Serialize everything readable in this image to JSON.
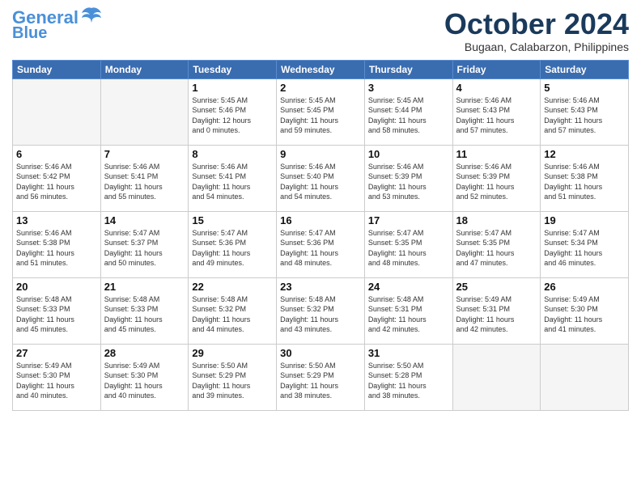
{
  "header": {
    "logo_line1": "General",
    "logo_line2": "Blue",
    "month": "October 2024",
    "location": "Bugaan, Calabarzon, Philippines"
  },
  "days_of_week": [
    "Sunday",
    "Monday",
    "Tuesday",
    "Wednesday",
    "Thursday",
    "Friday",
    "Saturday"
  ],
  "weeks": [
    [
      {
        "day": "",
        "info": ""
      },
      {
        "day": "",
        "info": ""
      },
      {
        "day": "1",
        "info": "Sunrise: 5:45 AM\nSunset: 5:46 PM\nDaylight: 12 hours\nand 0 minutes."
      },
      {
        "day": "2",
        "info": "Sunrise: 5:45 AM\nSunset: 5:45 PM\nDaylight: 11 hours\nand 59 minutes."
      },
      {
        "day": "3",
        "info": "Sunrise: 5:45 AM\nSunset: 5:44 PM\nDaylight: 11 hours\nand 58 minutes."
      },
      {
        "day": "4",
        "info": "Sunrise: 5:46 AM\nSunset: 5:43 PM\nDaylight: 11 hours\nand 57 minutes."
      },
      {
        "day": "5",
        "info": "Sunrise: 5:46 AM\nSunset: 5:43 PM\nDaylight: 11 hours\nand 57 minutes."
      }
    ],
    [
      {
        "day": "6",
        "info": "Sunrise: 5:46 AM\nSunset: 5:42 PM\nDaylight: 11 hours\nand 56 minutes."
      },
      {
        "day": "7",
        "info": "Sunrise: 5:46 AM\nSunset: 5:41 PM\nDaylight: 11 hours\nand 55 minutes."
      },
      {
        "day": "8",
        "info": "Sunrise: 5:46 AM\nSunset: 5:41 PM\nDaylight: 11 hours\nand 54 minutes."
      },
      {
        "day": "9",
        "info": "Sunrise: 5:46 AM\nSunset: 5:40 PM\nDaylight: 11 hours\nand 54 minutes."
      },
      {
        "day": "10",
        "info": "Sunrise: 5:46 AM\nSunset: 5:39 PM\nDaylight: 11 hours\nand 53 minutes."
      },
      {
        "day": "11",
        "info": "Sunrise: 5:46 AM\nSunset: 5:39 PM\nDaylight: 11 hours\nand 52 minutes."
      },
      {
        "day": "12",
        "info": "Sunrise: 5:46 AM\nSunset: 5:38 PM\nDaylight: 11 hours\nand 51 minutes."
      }
    ],
    [
      {
        "day": "13",
        "info": "Sunrise: 5:46 AM\nSunset: 5:38 PM\nDaylight: 11 hours\nand 51 minutes."
      },
      {
        "day": "14",
        "info": "Sunrise: 5:47 AM\nSunset: 5:37 PM\nDaylight: 11 hours\nand 50 minutes."
      },
      {
        "day": "15",
        "info": "Sunrise: 5:47 AM\nSunset: 5:36 PM\nDaylight: 11 hours\nand 49 minutes."
      },
      {
        "day": "16",
        "info": "Sunrise: 5:47 AM\nSunset: 5:36 PM\nDaylight: 11 hours\nand 48 minutes."
      },
      {
        "day": "17",
        "info": "Sunrise: 5:47 AM\nSunset: 5:35 PM\nDaylight: 11 hours\nand 48 minutes."
      },
      {
        "day": "18",
        "info": "Sunrise: 5:47 AM\nSunset: 5:35 PM\nDaylight: 11 hours\nand 47 minutes."
      },
      {
        "day": "19",
        "info": "Sunrise: 5:47 AM\nSunset: 5:34 PM\nDaylight: 11 hours\nand 46 minutes."
      }
    ],
    [
      {
        "day": "20",
        "info": "Sunrise: 5:48 AM\nSunset: 5:33 PM\nDaylight: 11 hours\nand 45 minutes."
      },
      {
        "day": "21",
        "info": "Sunrise: 5:48 AM\nSunset: 5:33 PM\nDaylight: 11 hours\nand 45 minutes."
      },
      {
        "day": "22",
        "info": "Sunrise: 5:48 AM\nSunset: 5:32 PM\nDaylight: 11 hours\nand 44 minutes."
      },
      {
        "day": "23",
        "info": "Sunrise: 5:48 AM\nSunset: 5:32 PM\nDaylight: 11 hours\nand 43 minutes."
      },
      {
        "day": "24",
        "info": "Sunrise: 5:48 AM\nSunset: 5:31 PM\nDaylight: 11 hours\nand 42 minutes."
      },
      {
        "day": "25",
        "info": "Sunrise: 5:49 AM\nSunset: 5:31 PM\nDaylight: 11 hours\nand 42 minutes."
      },
      {
        "day": "26",
        "info": "Sunrise: 5:49 AM\nSunset: 5:30 PM\nDaylight: 11 hours\nand 41 minutes."
      }
    ],
    [
      {
        "day": "27",
        "info": "Sunrise: 5:49 AM\nSunset: 5:30 PM\nDaylight: 11 hours\nand 40 minutes."
      },
      {
        "day": "28",
        "info": "Sunrise: 5:49 AM\nSunset: 5:30 PM\nDaylight: 11 hours\nand 40 minutes."
      },
      {
        "day": "29",
        "info": "Sunrise: 5:50 AM\nSunset: 5:29 PM\nDaylight: 11 hours\nand 39 minutes."
      },
      {
        "day": "30",
        "info": "Sunrise: 5:50 AM\nSunset: 5:29 PM\nDaylight: 11 hours\nand 38 minutes."
      },
      {
        "day": "31",
        "info": "Sunrise: 5:50 AM\nSunset: 5:28 PM\nDaylight: 11 hours\nand 38 minutes."
      },
      {
        "day": "",
        "info": ""
      },
      {
        "day": "",
        "info": ""
      }
    ]
  ]
}
